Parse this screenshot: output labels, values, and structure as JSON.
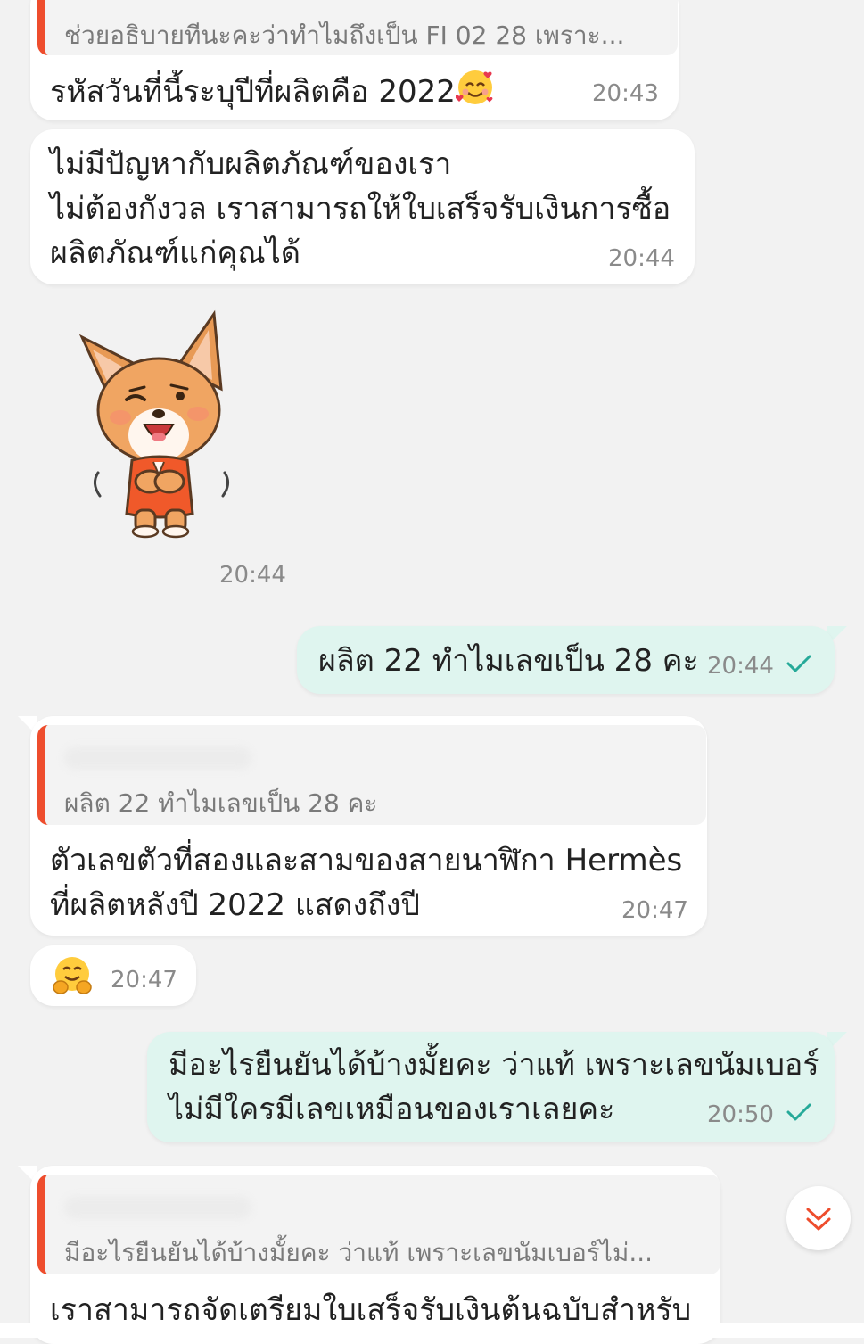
{
  "messages": {
    "m1": {
      "quote": "ช่วยอธิบายทีนะคะว่าทำไมถึงเป็น FI 02 28 เพราะ...",
      "text": "รหัสวันที่นี้ระบุปีที่ผลิตคือ 2022",
      "emoji": "smiling-face-with-hearts",
      "time": "20:43"
    },
    "m2": {
      "lines": [
        "ไม่มีปัญหากับผลิตภัณฑ์ของเรา",
        "ไม่ต้องกังวล เราสามารถให้ใบเสร็จรับเงินการซื้อ",
        "ผลิตภัณฑ์แก่คุณได้"
      ],
      "time": "20:44"
    },
    "m3": {
      "sticker": "corgi-bowing-sticker",
      "time": "20:44"
    },
    "m4": {
      "text": "ผลิต 22 ทำไมเลขเป็น 28 คะ",
      "time": "20:44",
      "status": "sent-check"
    },
    "m5": {
      "quote": "ผลิต 22 ทำไมเลขเป็น 28 คะ",
      "lines": [
        "ตัวเลขตัวที่สองและสามของสายนาฬิกา Hermès",
        "ที่ผลิตหลังปี 2022 แสดงถึงปี"
      ],
      "time": "20:47"
    },
    "m6": {
      "emoji": "hugging-face",
      "time": "20:47"
    },
    "m7": {
      "lines": [
        "มีอะไรยืนยันได้บ้างมั้ยคะ ว่าแท้ เพราะเลขนัมเบอร์",
        "ไม่มีใครมีเลขเหมือนของเราเลยคะ"
      ],
      "time": "20:50",
      "status": "sent-check"
    },
    "m8": {
      "quote": "มีอะไรยืนยันได้บ้างมั้ยคะ ว่าแท้ เพราะเลขนัมเบอร์ไม่...",
      "text": "เราสามารถจัดเตรียมใบเสร็จรับเงินต้นฉบับสำหรับ"
    }
  },
  "colors": {
    "accent": "#ee4d2d",
    "outgoing_bubble": "#dff5ef",
    "incoming_bubble": "#ffffff",
    "check": "#26aa99",
    "background": "#f2f2f2"
  },
  "scroll_button": {
    "icon": "double-chevron-down-icon"
  }
}
